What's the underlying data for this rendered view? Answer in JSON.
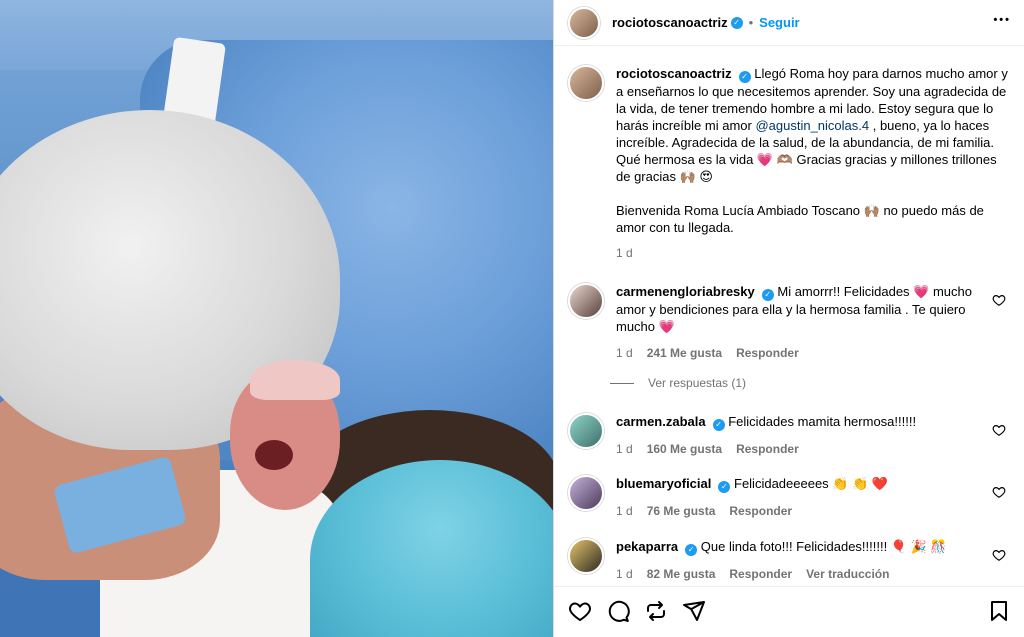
{
  "post": {
    "username": "rociotoscanoactriz",
    "follow_label": "Seguir",
    "more_label": "•••",
    "caption_username": "rociotoscanoactriz",
    "caption_part1": "Llegó Roma hoy para darnos mucho amor y a enseñarnos lo que necesitemos aprender. Soy una agradecida de la vida, de tener tremendo hombre a mi lado. Estoy segura que lo harás increíble mi amor ",
    "caption_mention": "@agustin_nicolas.4",
    "caption_part2": " , bueno, ya lo haces increíble. Agradecida de la salud, de la abundancia, de mi familia. Qué hermosa es la vida 💗 🫶🏽 Gracias gracias y millones trillones de gracias 🙌🏽 😍",
    "caption_part3": "Bienvenida Roma Lucía Ambiado Toscano 🙌🏽 no puedo más de amor con tu llegada.",
    "caption_time": "1 d"
  },
  "comments": [
    {
      "username": "carmenengloriabresky",
      "text": "Mi amorrr!! Felicidades 💗 mucho amor y bendiciones para ella y la hermosa familia . Te quiero mucho 💗",
      "time": "1 d",
      "likes": "241 Me gusta",
      "reply": "Responder",
      "view_replies": "Ver respuestas (1)"
    },
    {
      "username": "carmen.zabala",
      "text": "Felicidades mamita hermosa!!!!!!",
      "time": "1 d",
      "likes": "160 Me gusta",
      "reply": "Responder"
    },
    {
      "username": "bluemaryoficial",
      "text": "Felicidadeeeees 👏 👏 ❤️",
      "time": "1 d",
      "likes": "76 Me gusta",
      "reply": "Responder"
    },
    {
      "username": "pekaparra",
      "text": "Que linda foto!!! Felicidades!!!!!!! 🎈 🎉 🎊",
      "time": "1 d",
      "likes": "82 Me gusta",
      "reply": "Responder",
      "translate": "Ver traducción"
    }
  ],
  "colors": {
    "link": "#0095f6",
    "mention": "#00376b",
    "muted": "#737373",
    "verified": "#1d9bf0"
  },
  "icons": [
    "heart-icon",
    "comment-icon",
    "repost-icon",
    "share-icon",
    "bookmark-icon",
    "more-icon",
    "verified-icon"
  ]
}
